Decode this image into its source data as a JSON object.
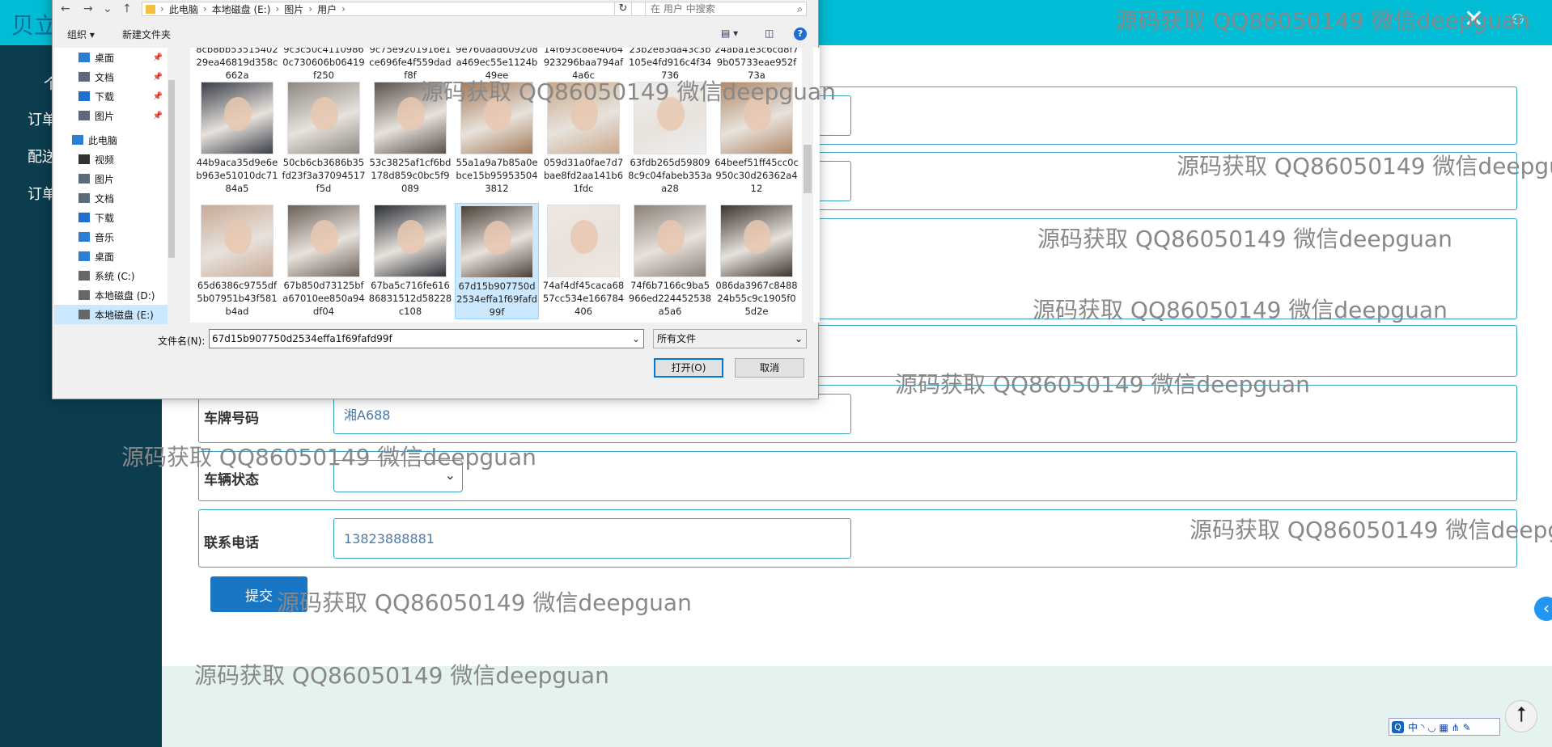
{
  "app": {
    "brand": "贝立",
    "close_glyph": "✕",
    "user_glyph": "⚇"
  },
  "sidebar": {
    "items": [
      "个",
      "订单",
      "配送",
      "订单"
    ]
  },
  "form": {
    "plate_label": "车牌号码",
    "plate_value": "湘A688",
    "status_label": "车辆状态",
    "status_value": "",
    "phone_label": "联系电话",
    "phone_value": "13823888881",
    "submit_label": "提交"
  },
  "watermark": "源码获取 QQ86050149 微信deepguan",
  "float_arrow": "‹",
  "ime": {
    "text": "中 ◝ ◡ ▦ ⋔ ✎"
  },
  "backtop": "⭡",
  "dialog": {
    "breadcrumbs": [
      "此电脑",
      "本地磁盘 (E:)",
      "图片",
      "用户"
    ],
    "search_placeholder": "在 用户 中搜索",
    "organize": "组织 ▾",
    "new_folder": "新建文件夹",
    "help": "?",
    "nav_items": [
      {
        "label": "桌面",
        "pinned": true,
        "color": "#2a7fd4",
        "selected": false
      },
      {
        "label": "文档",
        "pinned": true,
        "color": "#5a6a7a",
        "selected": false
      },
      {
        "label": "下载",
        "pinned": true,
        "color": "#1e6fd1",
        "selected": false
      },
      {
        "label": "图片",
        "pinned": true,
        "color": "#5a6a7a",
        "selected": false
      },
      {
        "label": "此电脑",
        "pinned": false,
        "color": "#2a7fd4",
        "selected": false
      },
      {
        "label": "视频",
        "pinned": false,
        "color": "#333",
        "selected": false
      },
      {
        "label": "图片",
        "pinned": false,
        "color": "#5a6a7a",
        "selected": false
      },
      {
        "label": "文档",
        "pinned": false,
        "color": "#5a6a7a",
        "selected": false
      },
      {
        "label": "下载",
        "pinned": false,
        "color": "#1e6fd1",
        "selected": false
      },
      {
        "label": "音乐",
        "pinned": false,
        "color": "#2a7fd4",
        "selected": false
      },
      {
        "label": "桌面",
        "pinned": false,
        "color": "#2a7fd4",
        "selected": false
      },
      {
        "label": "系统 (C:)",
        "pinned": false,
        "color": "#666",
        "selected": false
      },
      {
        "label": "本地磁盘 (D:)",
        "pinned": false,
        "color": "#666",
        "selected": false
      },
      {
        "label": "本地磁盘 (E:)",
        "pinned": false,
        "color": "#666",
        "selected": true
      }
    ],
    "files": [
      {
        "name": "8cb8bb5351540229ea46819d358c662a",
        "color": "#d8d2cc",
        "selected": false
      },
      {
        "name": "9c3c50c41109860c730606b06419f250",
        "color": "#c8c0b8",
        "selected": false
      },
      {
        "name": "9c75e9201916e1ce696fe4f559dadf8f",
        "color": "#b0a8a0",
        "selected": false
      },
      {
        "name": "9e760aad609208a469ec55e1124b49ee",
        "color": "#d0c4b8",
        "selected": false
      },
      {
        "name": "14f693c88e4064923296baa794af4a6c",
        "color": "#c0b8b0",
        "selected": false
      },
      {
        "name": "23b2e83da43c3b105e4fd916c4f34736",
        "color": "#ddd5cc",
        "selected": false
      },
      {
        "name": "24aba1e3c6cd8f79b05733eae952f73a",
        "color": "#c0b4a8",
        "selected": false
      },
      {
        "name": "44b9aca35d9e6eb963e51010dc7184a5",
        "color": "#3a3f4a",
        "selected": false
      },
      {
        "name": "50cb6cb3686b35fd23f3a37094517f5d",
        "color": "#8e8882",
        "selected": false
      },
      {
        "name": "53c3825af1cf6bd178d859c0bc5f9089",
        "color": "#5a504c",
        "selected": false
      },
      {
        "name": "55a1a9a7b85a0ebce15b959535043812",
        "color": "#a47a5a",
        "selected": false
      },
      {
        "name": "059d31a0fae7d7bae8fd2aa141b61fdc",
        "color": "#c9a98a",
        "selected": false
      },
      {
        "name": "63fdb265d598098c9c04fabeb353aa28",
        "color": "#eeeeee",
        "selected": false
      },
      {
        "name": "64beef51ff45cc0c950c30d26362a412",
        "color": "#b08868",
        "selected": false
      },
      {
        "name": "65d6386c9755df5b07951b43f581b4ad",
        "color": "#c8aa96",
        "selected": false
      },
      {
        "name": "67b850d73125bfa67010ee850a94df04",
        "color": "#6a6058",
        "selected": false
      },
      {
        "name": "67ba5c716fe61686831512d58228c108",
        "color": "#2c3038",
        "selected": false
      },
      {
        "name": "67d15b907750d2534effa1f69fafd99f",
        "color": "#4a4038",
        "selected": true
      },
      {
        "name": "74af4df45caca6857cc534e166784406",
        "color": "#f0e8e0",
        "selected": false
      },
      {
        "name": "74f6b7166c9ba5966ed224452538a5a6",
        "color": "#8a8078",
        "selected": false
      },
      {
        "name": "086da3967c848824b55c9c1905f05d2e",
        "color": "#3c342e",
        "selected": false
      }
    ],
    "filename_label": "文件名(N):",
    "filename_value": "67d15b907750d2534effa1f69fafd99f",
    "filter_value": "所有文件",
    "open_label": "打开(O)",
    "cancel_label": "取消"
  }
}
